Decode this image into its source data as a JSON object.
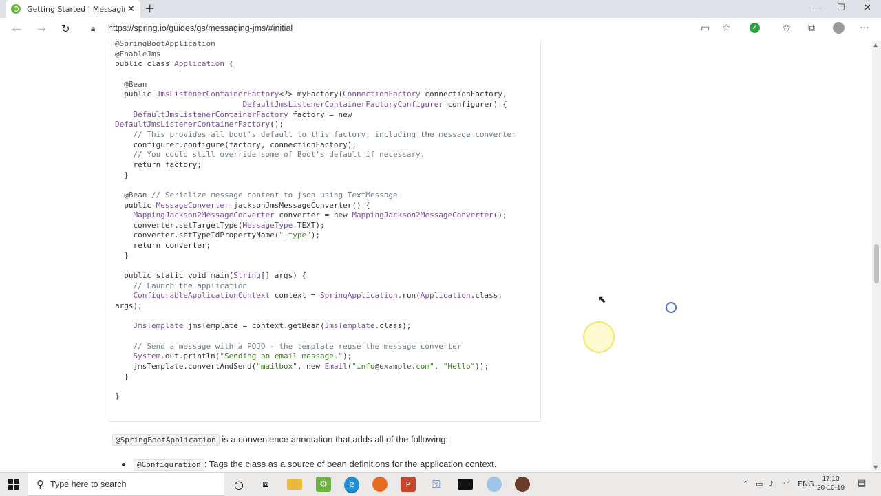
{
  "browser": {
    "tab_title": "Getting Started | Messaging with",
    "url": "https://spring.io/guides/gs/messaging-jms/#initial",
    "new_tab": "+",
    "tab_close": "✕"
  },
  "code_lines": [
    "@SpringBootApplication",
    "@EnableJms",
    "public class Application {",
    "",
    "  @Bean",
    "  public JmsListenerContainerFactory<?> myFactory(ConnectionFactory connectionFactory,",
    "                            DefaultJmsListenerContainerFactoryConfigurer configurer) {",
    "    DefaultJmsListenerContainerFactory factory = new",
    "DefaultJmsListenerContainerFactory();",
    "    // This provides all boot's default to this factory, including the message converter",
    "    configurer.configure(factory, connectionFactory);",
    "    // You could still override some of Boot's default if necessary.",
    "    return factory;",
    "  }",
    "",
    "  @Bean // Serialize message content to json using TextMessage",
    "  public MessageConverter jacksonJmsMessageConverter() {",
    "    MappingJackson2MessageConverter converter = new MappingJackson2MessageConverter();",
    "    converter.setTargetType(MessageType.TEXT);",
    "    converter.setTypeIdPropertyName(\"_type\");",
    "    return converter;",
    "  }",
    "",
    "  public static void main(String[] args) {",
    "    // Launch the application",
    "    ConfigurableApplicationContext context = SpringApplication.run(Application.class,",
    "args);",
    "",
    "    JmsTemplate jmsTemplate = context.getBean(JmsTemplate.class);",
    "",
    "    // Send a message with a POJO - the template reuse the message converter",
    "    System.out.println(\"Sending an email message.\");",
    "    jmsTemplate.convertAndSend(\"mailbox\", new Email(\"info@example.com\", \"Hello\"));",
    "  }",
    "",
    "}"
  ],
  "paragraph": {
    "code": "@SpringBootApplication",
    "text": " is a convenience annotation that adds all of the following:"
  },
  "bullet": {
    "code": "@Configuration",
    "text": ": Tags the class as a source of bean definitions for the application context."
  },
  "taskbar": {
    "search_placeholder": "Type here to search",
    "lang": "ENG",
    "time": "17:10",
    "date": "20-10-19"
  },
  "icons": [
    "back-icon",
    "forward-icon",
    "refresh-icon",
    "lock-icon",
    "reader-icon",
    "favorite-icon",
    "shield-icon",
    "favorites-icon",
    "collections-icon",
    "profile-icon",
    "more-icon"
  ]
}
